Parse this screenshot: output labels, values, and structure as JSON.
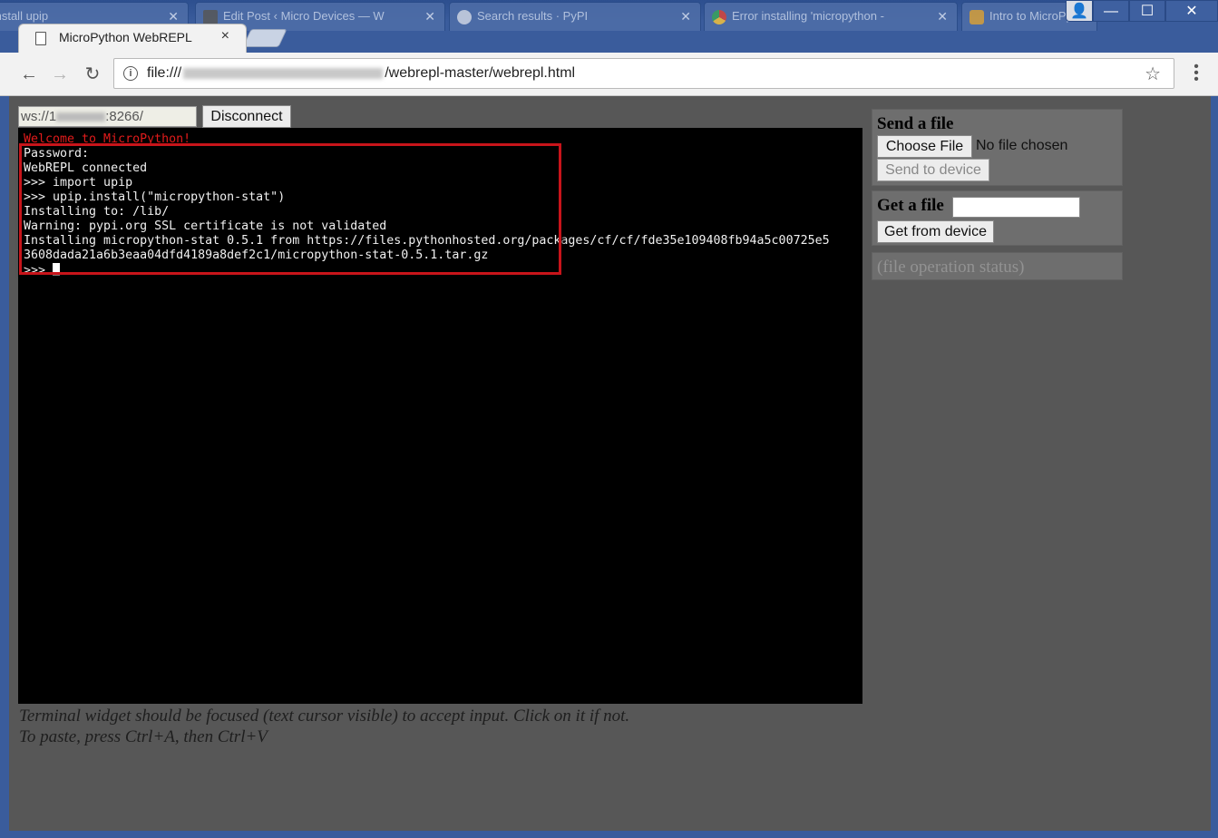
{
  "browser": {
    "background_tabs": [
      {
        "label": "Install upip"
      },
      {
        "label": "Edit Post ‹ Micro Devices — W"
      },
      {
        "label": "Search results · PyPI"
      },
      {
        "label": "Error installing 'micropython -"
      },
      {
        "label": "Intro to MicroPy"
      }
    ],
    "active_tab": {
      "title": "MicroPython WebREPL",
      "close": "×"
    },
    "address": {
      "prefix": "file:///",
      "path": "/webrepl-master/webrepl.html"
    },
    "controls": {
      "minimize": "—",
      "maximize": "☐",
      "close": "✕"
    }
  },
  "webrepl": {
    "url_prefix": "ws://1",
    "url_suffix": ":8266/",
    "disconnect_label": "Disconnect",
    "terminal": {
      "welcome": "Welcome to MicroPython!",
      "lines": [
        "Password:",
        "WebREPL connected",
        ">>> import upip",
        ">>> upip.install(\"micropython-stat\")",
        "Installing to: /lib/",
        "Warning: pypi.org SSL certificate is not validated",
        "Installing micropython-stat 0.5.1 from https://files.pythonhosted.org/packages/cf/cf/fde35e109408fb94a5c00725e5",
        "3608dada21a6b3eaa04dfd4189a8def2c1/micropython-stat-0.5.1.tar.gz"
      ],
      "prompt": ">>> "
    },
    "hint_line1": "Terminal widget should be focused (text cursor visible) to accept input. Click on it if not.",
    "hint_line2": "To paste, press Ctrl+A, then Ctrl+V",
    "send_file": {
      "title": "Send a file",
      "choose_label": "Choose File",
      "no_file": "No file chosen",
      "send_label": "Send to device"
    },
    "get_file": {
      "title": "Get a file",
      "input_value": "",
      "get_label": "Get from device"
    },
    "status": "(file operation status)"
  },
  "colors": {
    "page_bg": "#575757",
    "panel_bg": "#6e6e6e",
    "terminal_bg": "#000000",
    "welcome_red": "#e21b1b",
    "highlight_red": "#c8141a"
  }
}
